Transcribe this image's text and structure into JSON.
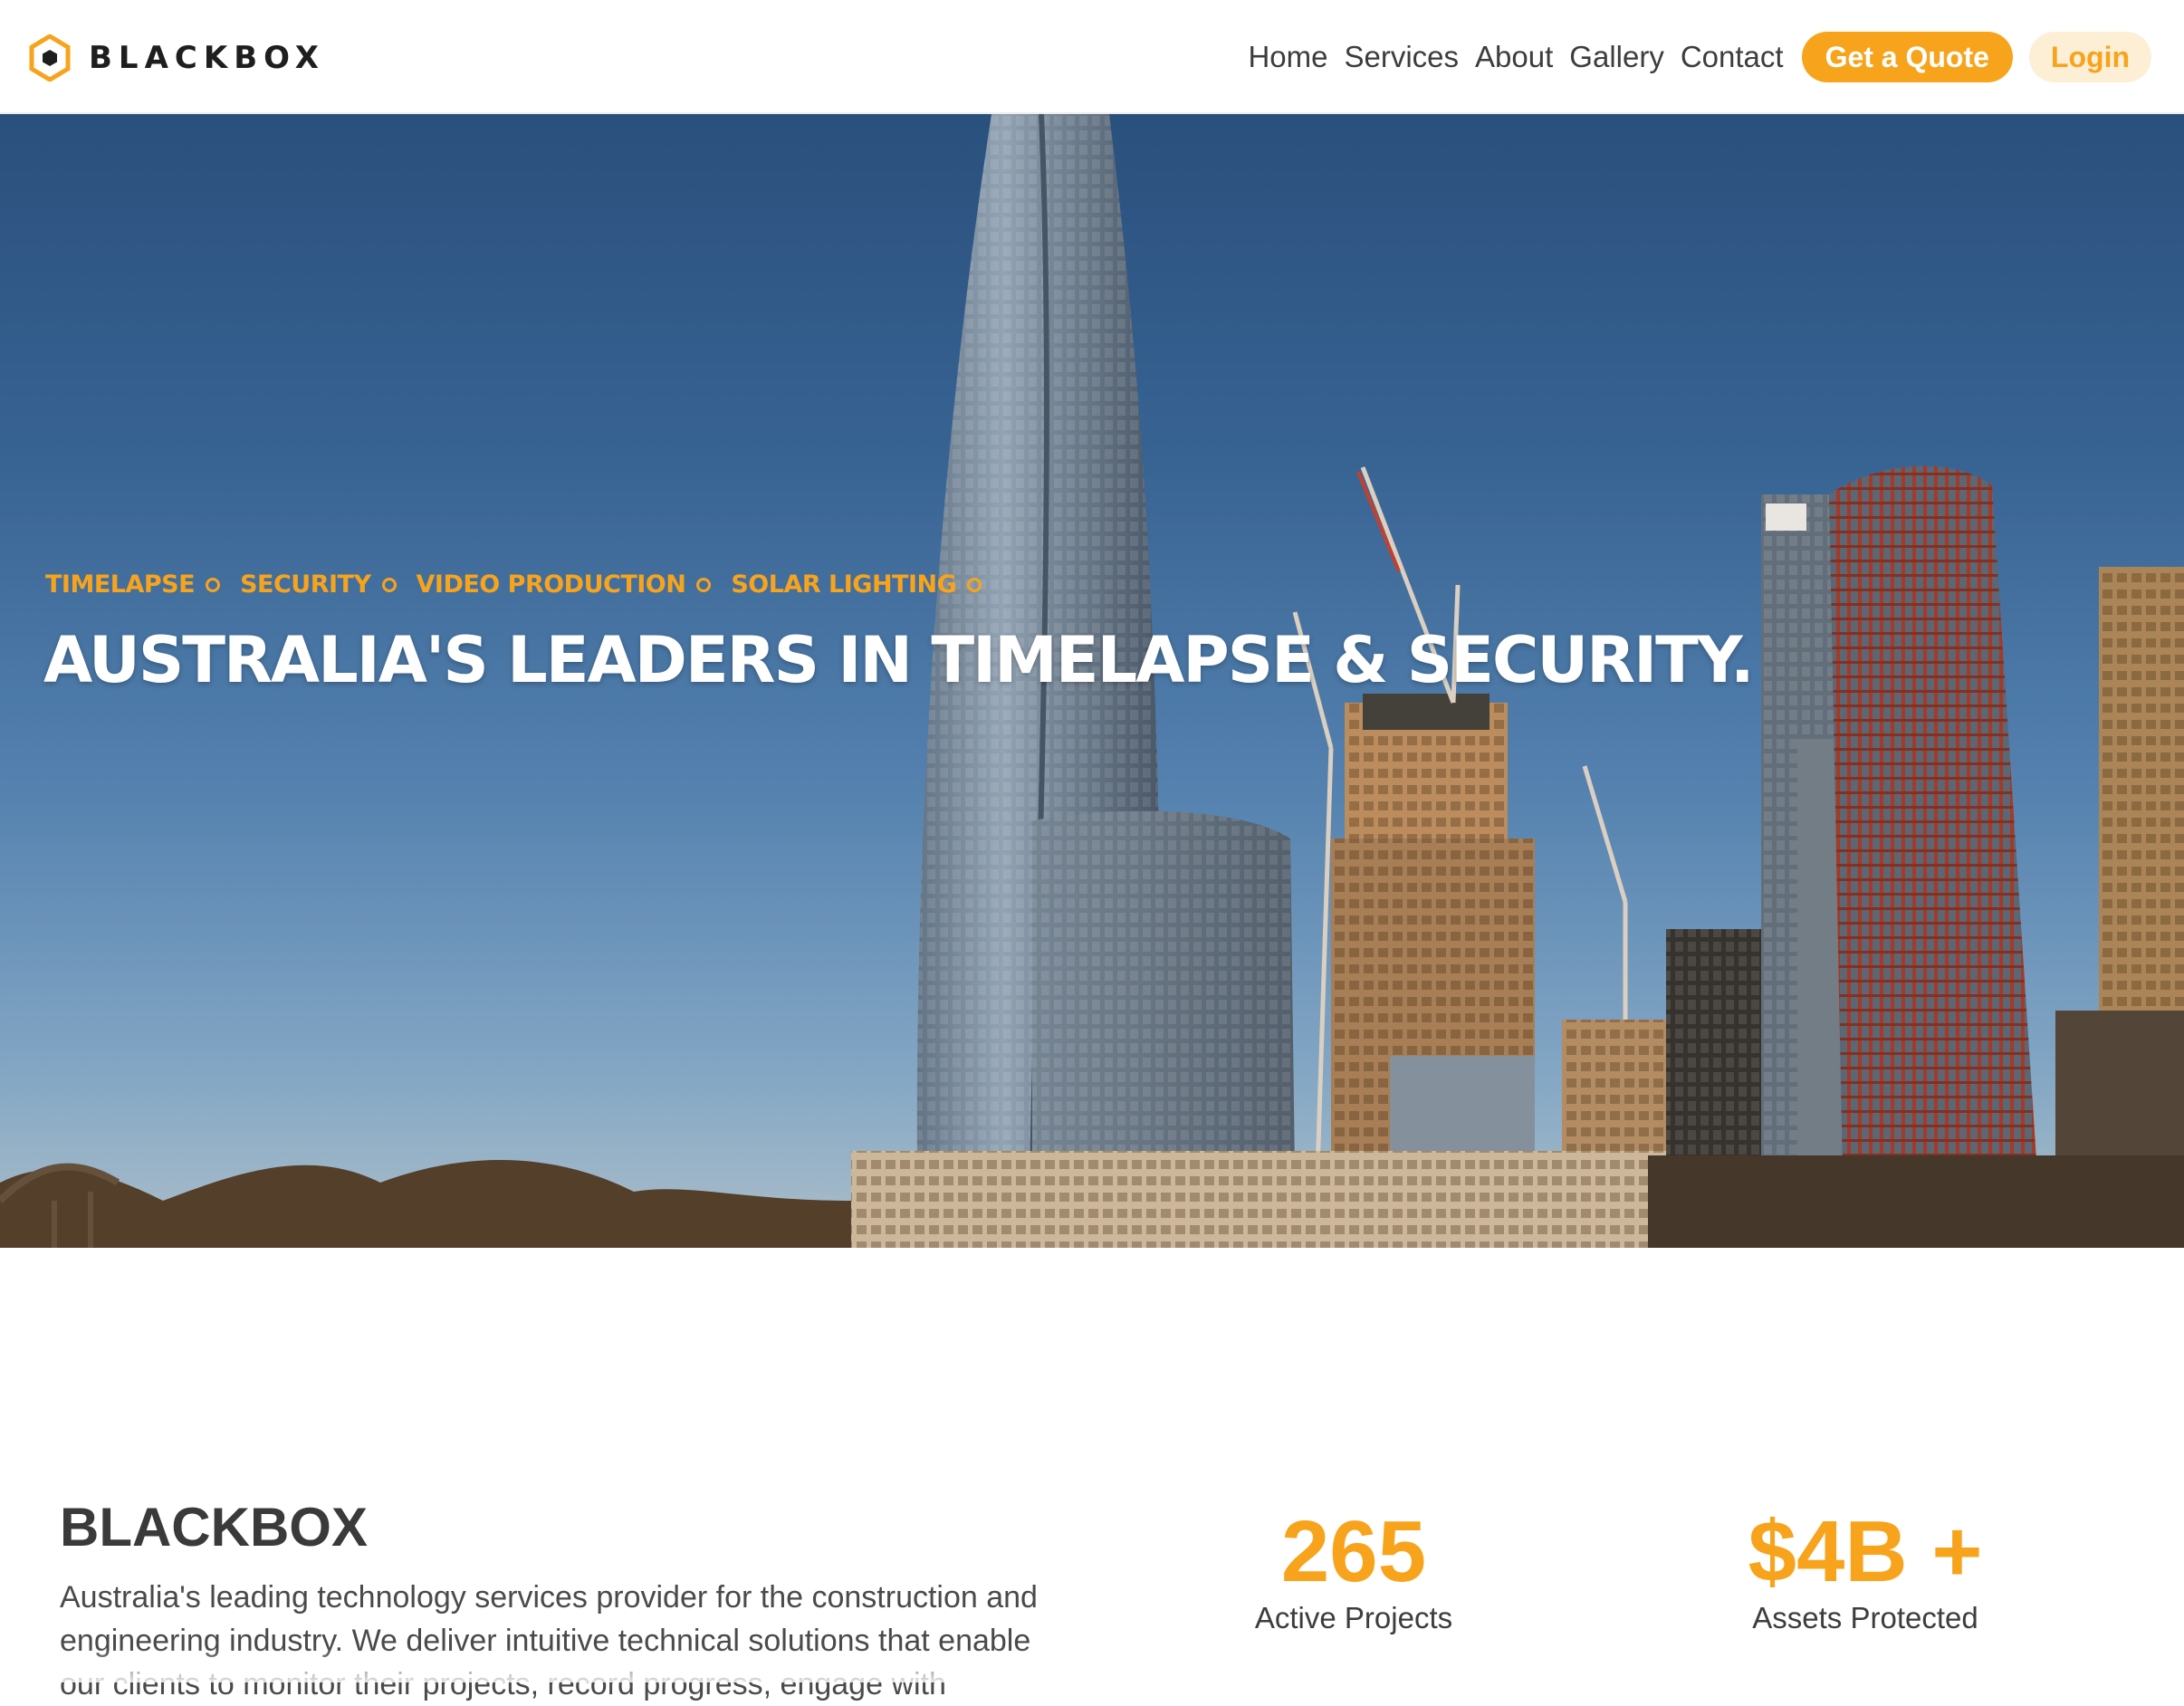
{
  "brand": {
    "name": "BLACKBOX",
    "accent": "#f7a41c",
    "dark": "#1e1e1e"
  },
  "nav": {
    "items": [
      {
        "label": "Home"
      },
      {
        "label": "Services"
      },
      {
        "label": "About"
      },
      {
        "label": "Gallery"
      },
      {
        "label": "Contact"
      }
    ],
    "quote_label": "Get a Quote",
    "login_label": "Login"
  },
  "hero": {
    "tags": [
      "TIMELAPSE",
      "SECURITY",
      "VIDEO PRODUCTION",
      "SOLAR LIGHTING"
    ],
    "title": "AUSTRALIA'S LEADERS IN TIMELAPSE & SECURITY."
  },
  "about": {
    "title": "BLACKBOX",
    "text": "Australia's leading technology services provider for the construction and engineering industry. We deliver intuitive technical solutions that enable our clients to monitor their projects, record progress, engage with"
  },
  "stats": [
    {
      "value": "265",
      "label": "Active Projects"
    },
    {
      "value": "$4B +",
      "label": "Assets Protected"
    }
  ]
}
